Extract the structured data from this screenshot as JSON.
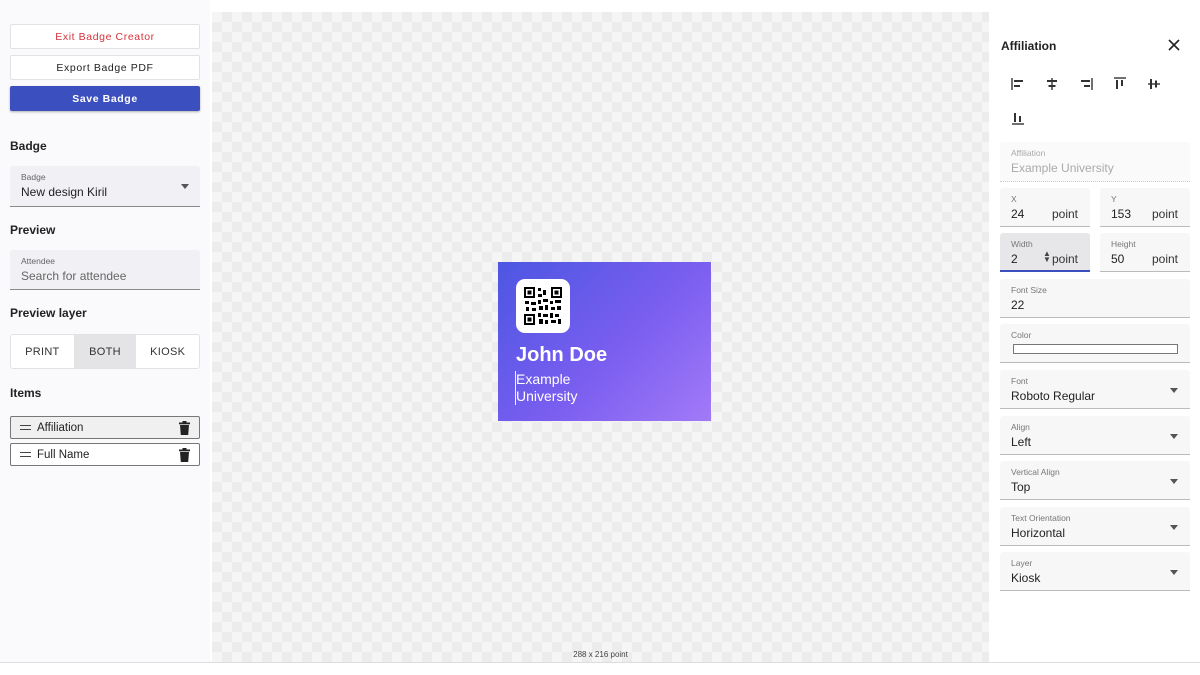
{
  "left": {
    "buttons": {
      "exit": "Exit Badge Creator",
      "export": "Export Badge PDF",
      "save": "Save Badge"
    },
    "badge_section": {
      "title": "Badge",
      "select_label": "Badge",
      "select_value": "New design Kiril"
    },
    "preview_section": {
      "title": "Preview",
      "attendee_label": "Attendee",
      "attendee_placeholder": "Search for attendee"
    },
    "preview_layer": {
      "title": "Preview layer",
      "options": [
        "PRINT",
        "BOTH",
        "KIOSK"
      ],
      "selected": "BOTH"
    },
    "items_section": {
      "title": "Items",
      "items": [
        "Affiliation",
        "Full Name"
      ]
    }
  },
  "canvas": {
    "badge": {
      "name": "John Doe",
      "affiliation_line1": "Example",
      "affiliation_line2": "University"
    },
    "dimensions": "288 x 216 point"
  },
  "right": {
    "title": "Affiliation",
    "affiliation": {
      "label": "Affiliation",
      "value": "Example University"
    },
    "x": {
      "label": "X",
      "value": "24",
      "unit": "point"
    },
    "y": {
      "label": "Y",
      "value": "153",
      "unit": "point"
    },
    "width": {
      "label": "Width",
      "value": "2",
      "unit": "point"
    },
    "height": {
      "label": "Height",
      "value": "50",
      "unit": "point"
    },
    "font_size": {
      "label": "Font Size",
      "value": "22"
    },
    "color": {
      "label": "Color",
      "value": "#ffffff"
    },
    "font": {
      "label": "Font",
      "value": "Roboto Regular"
    },
    "align": {
      "label": "Align",
      "value": "Left"
    },
    "vertical_align": {
      "label": "Vertical Align",
      "value": "Top"
    },
    "text_orientation": {
      "label": "Text Orientation",
      "value": "Horizontal"
    },
    "layer": {
      "label": "Layer",
      "value": "Kiosk"
    }
  },
  "colors": {
    "primary": "#3c4fbf",
    "danger": "#d6343b",
    "badge_gradient_start": "#4c56e2",
    "badge_gradient_end": "#a27af7"
  }
}
